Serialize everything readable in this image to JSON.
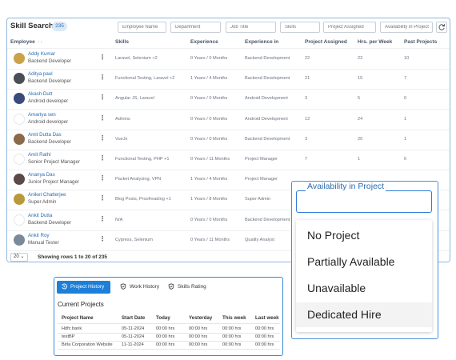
{
  "header": {
    "title": "Skill Search",
    "count": "235",
    "filters": [
      "Employee Name",
      "Department",
      "Job Title",
      "Skills",
      "Project Assigned",
      "Availability in Project"
    ],
    "refresh_icon": "refresh-icon"
  },
  "columns": {
    "employee": "Employee",
    "employee_sort": "↑↓",
    "skills": "Skills",
    "experience": "Experience",
    "experience_in": "Experience in",
    "project_assigned": "Project Assigned",
    "hrs_per_week": "Hrs. per Week",
    "past_projects": "Past Projects"
  },
  "rows": [
    {
      "name": "Addy Kumar",
      "role": "Backend Developer",
      "skills": "Laravel, Selenium +2",
      "experience": "0 Years / 0 Months",
      "experience_in": "Backend Development",
      "project_assigned": "22",
      "hrs": "23",
      "past": "10",
      "avatar_color": "#c9a24a"
    },
    {
      "name": "Aditya paul",
      "role": "Backend Developer",
      "skills": "Functional Testing, Laravel +2",
      "experience": "1 Years / 4 Months",
      "experience_in": "Backend Development",
      "project_assigned": "21",
      "hrs": "15",
      "past": "7",
      "avatar_color": "#4a4f57"
    },
    {
      "name": "Akash Dutt",
      "role": "Android developer",
      "skills": "Angular JS, Laravel",
      "experience": "0 Years / 0 Months",
      "experience_in": "Android Development",
      "project_assigned": "3",
      "hrs": "5",
      "past": "0",
      "avatar_color": "#3a4a7a"
    },
    {
      "name": "Amartya sen",
      "role": "Android developer",
      "skills": "Admins",
      "experience": "0 Years / 0 Months",
      "experience_in": "Android Development",
      "project_assigned": "12",
      "hrs": "24",
      "past": "1",
      "avatar_color": "#ffffff"
    },
    {
      "name": "Amit Dutta Das",
      "role": "Backend Developer",
      "skills": "VueJs",
      "experience": "0 Years / 0 Months",
      "experience_in": "Backend Development",
      "project_assigned": "3",
      "hrs": "20",
      "past": "1",
      "avatar_color": "#8a6a4a"
    },
    {
      "name": "Amit Rathi",
      "role": "Senior Project Manager",
      "skills": "Functional Testing, PHP +1",
      "experience": "0 Years / 11 Months",
      "experience_in": "Project Manager",
      "project_assigned": "7",
      "hrs": "1",
      "past": "6",
      "avatar_color": "#ffffff"
    },
    {
      "name": "Ananya Das",
      "role": "Junior Project Manager",
      "skills": "Packet Analyzing, VPN",
      "experience": "1 Years / 4 Months",
      "experience_in": "Project Manager",
      "project_assigned": "",
      "hrs": "",
      "past": "",
      "avatar_color": "#5a4a4a"
    },
    {
      "name": "Aniket Chatterjee",
      "role": "Super Admin",
      "skills": "Blog Posts, Proofreading +1",
      "experience": "1 Years / 8 Months",
      "experience_in": "Super Admin",
      "project_assigned": "",
      "hrs": "",
      "past": "",
      "avatar_color": "#b89a3a"
    },
    {
      "name": "Ankit Dutta",
      "role": "Backend Developer",
      "skills": "N/A",
      "experience": "0 Years / 0 Months",
      "experience_in": "Backend Development",
      "project_assigned": "",
      "hrs": "",
      "past": "",
      "avatar_color": "#ffffff"
    },
    {
      "name": "Ankit Roy",
      "role": "Manual Tester",
      "skills": "Cypress, Selenium",
      "experience": "0 Years / 11 Months",
      "experience_in": "Quality Analyst",
      "project_assigned": "",
      "hrs": "",
      "past": "",
      "avatar_color": "#7a8a9a"
    }
  ],
  "footer": {
    "page_size": "20",
    "showing": "Showing rows 1 to 20 of 235"
  },
  "availability": {
    "label": "Availability in Project",
    "options": [
      "No Project",
      "Partially Available",
      "Unavailable",
      "Dedicated Hire"
    ],
    "highlighted": "Dedicated Hire"
  },
  "history": {
    "tabs": [
      "Project History",
      "Work History",
      "Skills Rating"
    ],
    "section_title": "Current Projects",
    "headers": [
      "Project Name",
      "Start Date",
      "Today",
      "Yesterday",
      "This week",
      "Last week"
    ],
    "rows": [
      [
        "Hdfc bank",
        "05-11-2024",
        "00:00 hrs",
        "00:00 hrs",
        "00:00 hrs",
        "00:00 hrs"
      ],
      [
        "testBP",
        "05-11-2024",
        "00:00 hrs",
        "00:00 hrs",
        "00:00 hrs",
        "00:00 hrs"
      ],
      [
        "Birla Corporation Website",
        "11-11-2024",
        "00:00 hrs",
        "00:00 hrs",
        "00:00 hrs",
        "00:00 hrs"
      ]
    ]
  },
  "colors": {
    "accent": "#1e7fd8",
    "link": "#2b6cb0",
    "border": "#8fb7df"
  }
}
